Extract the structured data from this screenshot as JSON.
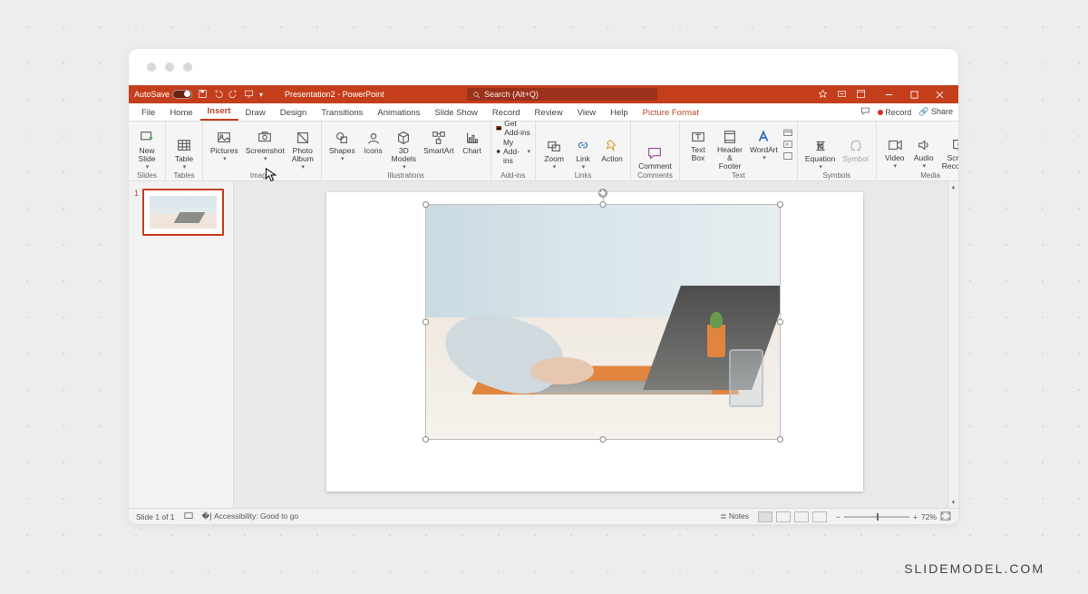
{
  "titlebar": {
    "autosave": "AutoSave",
    "doc": "Presentation2 - PowerPoint",
    "search_placeholder": "Search (Alt+Q)"
  },
  "tabs": {
    "file": "File",
    "home": "Home",
    "insert": "Insert",
    "draw": "Draw",
    "design": "Design",
    "transitions": "Transitions",
    "animations": "Animations",
    "slideshow": "Slide Show",
    "record": "Record",
    "review": "Review",
    "view": "View",
    "help": "Help",
    "context": "Picture Format",
    "record_btn": "Record",
    "share": "Share"
  },
  "ribbon": {
    "slides": {
      "new_slide": "New\nSlide",
      "group": "Slides"
    },
    "tables": {
      "table": "Table",
      "group": "Tables"
    },
    "images": {
      "pictures": "Pictures",
      "screenshot": "Screenshot",
      "album": "Photo\nAlbum",
      "group": "Images"
    },
    "illus": {
      "shapes": "Shapes",
      "icons": "Icons",
      "models": "3D\nModels",
      "smartart": "SmartArt",
      "chart": "Chart",
      "group": "Illustrations"
    },
    "addins": {
      "get": "Get Add-ins",
      "my": "My Add-ins",
      "group": "Add-ins"
    },
    "links": {
      "zoom": "Zoom",
      "link": "Link",
      "action": "Action",
      "group": "Links"
    },
    "comments": {
      "comment": "Comment",
      "group": "Comments"
    },
    "text": {
      "textbox": "Text\nBox",
      "hf": "Header\n& Footer",
      "wordart": "WordArt",
      "group": "Text"
    },
    "symbols": {
      "eq": "Equation",
      "sym": "Symbol",
      "group": "Symbols"
    },
    "media": {
      "video": "Video",
      "audio": "Audio",
      "screen": "Screen\nRecording",
      "group": "Media"
    }
  },
  "thumb": {
    "num": "1"
  },
  "status": {
    "slide": "Slide 1 of 1",
    "access": "Accessibility: Good to go",
    "notes": "Notes",
    "zoom": "72%"
  },
  "watermark": "SLIDEMODEL.COM"
}
